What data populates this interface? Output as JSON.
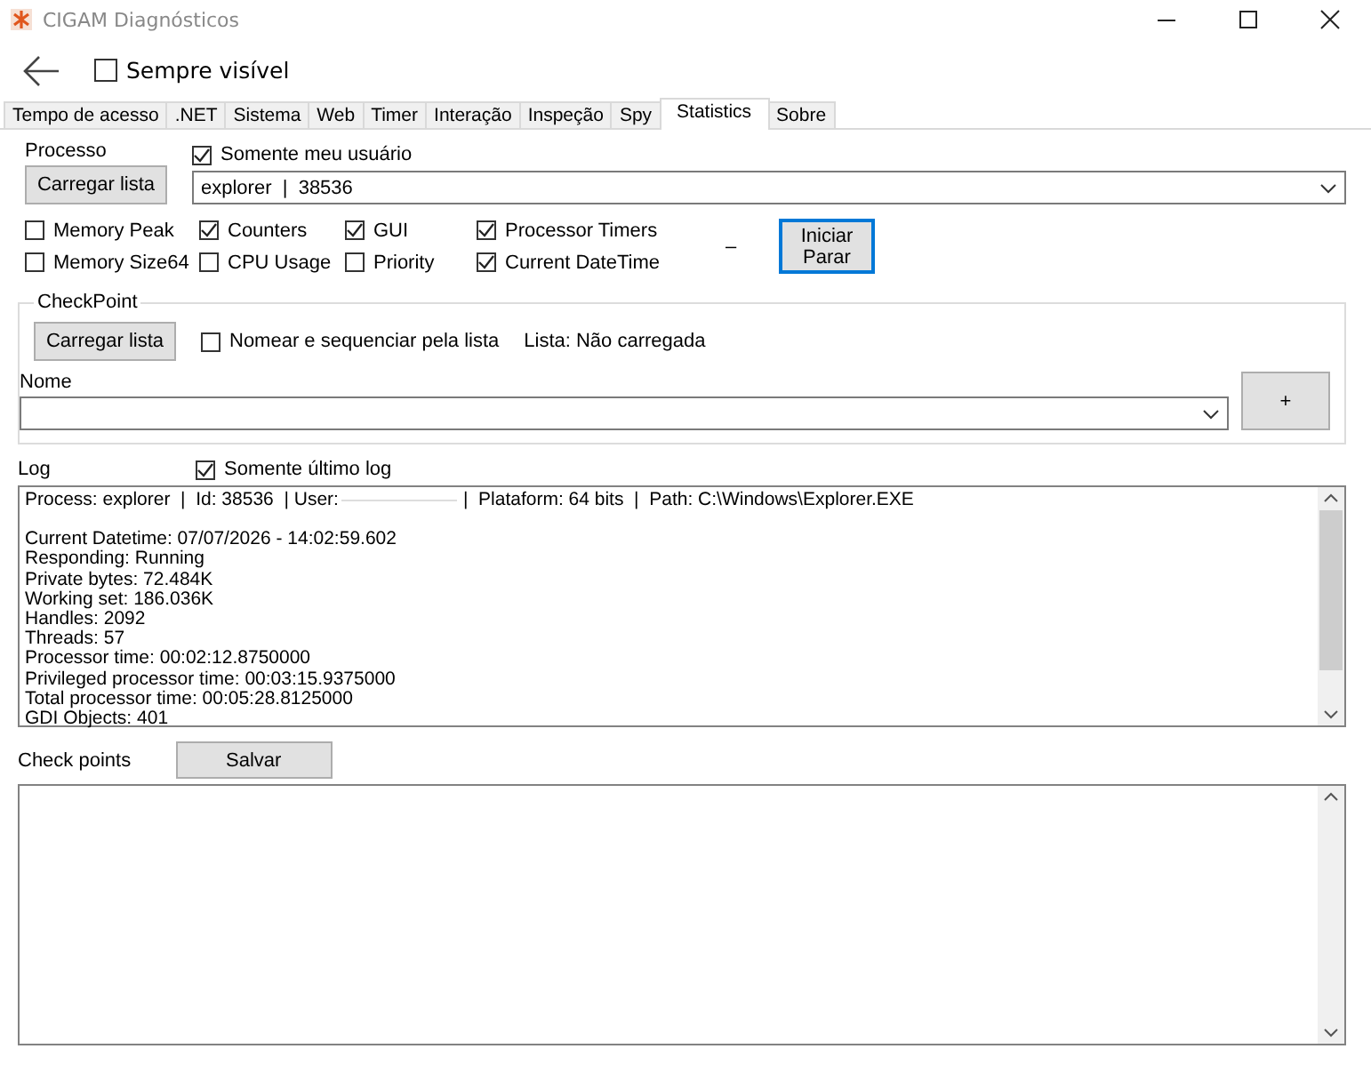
{
  "window": {
    "title": "CIGAM Diagnósticos"
  },
  "always_visible": {
    "label": "Sempre visível",
    "checked": false
  },
  "tabs": [
    {
      "label": "Tempo de acesso",
      "selected": false
    },
    {
      "label": ".NET",
      "selected": false
    },
    {
      "label": "Sistema",
      "selected": false
    },
    {
      "label": "Web",
      "selected": false
    },
    {
      "label": "Timer",
      "selected": false
    },
    {
      "label": "Interação",
      "selected": false
    },
    {
      "label": "Inspeção",
      "selected": false
    },
    {
      "label": "Spy",
      "selected": false
    },
    {
      "label": "Statistics",
      "selected": true
    },
    {
      "label": "Sobre",
      "selected": false
    }
  ],
  "process": {
    "label": "Processo",
    "load_button": "Carregar lista",
    "only_my_user": {
      "label": "Somente meu usuário",
      "checked": true
    },
    "value": "explorer  |  38536"
  },
  "options": [
    {
      "label": "Memory Peak",
      "checked": false
    },
    {
      "label": "Memory Size64",
      "checked": false
    },
    {
      "label": "Counters",
      "checked": true
    },
    {
      "label": "CPU Usage",
      "checked": false
    },
    {
      "label": "GUI",
      "checked": true
    },
    {
      "label": "Priority",
      "checked": false
    },
    {
      "label": "Processor Timers",
      "checked": true
    },
    {
      "label": "Current DateTime",
      "checked": true
    }
  ],
  "dash": "–",
  "start_stop_button": [
    "Iniciar",
    "Parar"
  ],
  "checkpoint": {
    "title": "CheckPoint",
    "load_button": "Carregar lista",
    "name_by_list": {
      "label": "Nomear e sequenciar pela lista",
      "checked": false
    },
    "list_status": "Lista: Não carregada",
    "name_label": "Nome",
    "add_button": "+"
  },
  "log": {
    "label": "Log",
    "only_last": {
      "label": "Somente último log",
      "checked": true
    },
    "header_left": "Process: explorer  |  Id: 38536  | User:",
    "header_right": "|  Plataform: 64 bits  |  Path: C:\\Windows\\Explorer.EXE",
    "lines": [
      "Current Datetime: 07/07/2026 - 14:02:59.602",
      "Responding: Running",
      "Private bytes: 72.484K",
      "Working set: 186.036K",
      "Handles: 2092",
      "Threads: 57",
      "Processor time: 00:02:12.8750000",
      "Privileged processor time: 00:03:15.9375000",
      "Total processor time: 00:05:28.8125000",
      "GDI Objects: 401"
    ]
  },
  "check_points": {
    "label": "Check points",
    "save_button": "Salvar"
  }
}
